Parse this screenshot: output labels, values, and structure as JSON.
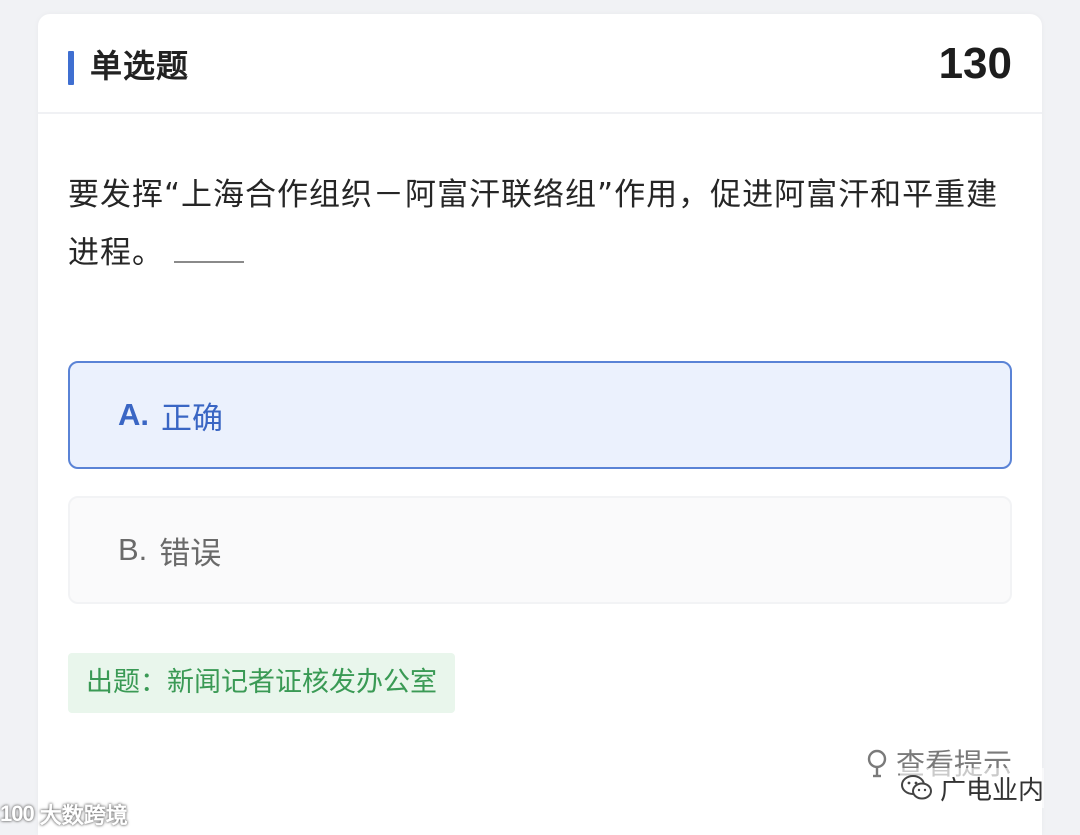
{
  "header": {
    "question_type": "单选题",
    "question_number": "130"
  },
  "question": {
    "text": "要发挥“上海合作组织－阿富汗联络组”作用，促进阿富汗和平重建进程。"
  },
  "options": [
    {
      "letter": "A.",
      "label": "正确",
      "selected": true
    },
    {
      "letter": "B.",
      "label": "错误",
      "selected": false
    }
  ],
  "source": "出题：新闻记者证核发办公室",
  "hint": {
    "label": "查看提示",
    "icon": "lightbulb-icon"
  },
  "watermarks": {
    "left_logo": "100",
    "left_text": "大数跨境",
    "right_text": "广电业内",
    "right_icon": "wechat-icon"
  },
  "colors": {
    "accent": "#3f6fd1",
    "selected_bg": "#ebf1fd",
    "source_text": "#3a9a55",
    "source_bg": "#e9f6ec"
  }
}
